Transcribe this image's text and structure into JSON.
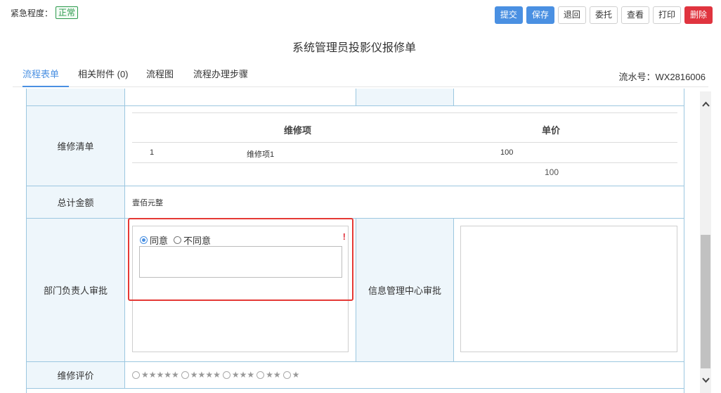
{
  "urgency": {
    "label": "紧急程度：",
    "value": "正常"
  },
  "toolbar": {
    "submit": "提交",
    "save": "保存",
    "return": "退回",
    "delegate": "委托",
    "view": "查看",
    "print": "打印",
    "delete": "删除"
  },
  "form_title": "系统管理员投影仪报修单",
  "tabs": [
    {
      "label": "流程表单"
    },
    {
      "label": "相关附件 (0)"
    },
    {
      "label": "流程图"
    },
    {
      "label": "流程办理步骤"
    }
  ],
  "serial": "流水号：WX2816006",
  "rows": {
    "repair_list": {
      "label": "维修清单",
      "headers": {
        "item": "维修项",
        "price": "单价"
      },
      "items": [
        {
          "no": "1",
          "item": "维修项1",
          "price": "100"
        }
      ],
      "total": "100"
    },
    "total_amount": {
      "label": "总计金额",
      "value": "壹佰元整"
    },
    "dept_approval": {
      "label": "部门负责人审批",
      "agree": "同意",
      "disagree": "不同意",
      "required_mark": "!"
    },
    "info_approval": {
      "label": "信息管理中心审批"
    },
    "rating": {
      "label": "维修评价",
      "options": [
        "★★★★★",
        "★★★★",
        "★★★",
        "★★",
        "★"
      ]
    }
  },
  "icons": {
    "scroll_up": "chevron-up-icon",
    "scroll_down": "chevron-down-icon"
  },
  "colors": {
    "primary": "#4a90e2",
    "danger": "#e0343f",
    "success": "#2e9b4e",
    "highlight": "#e53935"
  }
}
